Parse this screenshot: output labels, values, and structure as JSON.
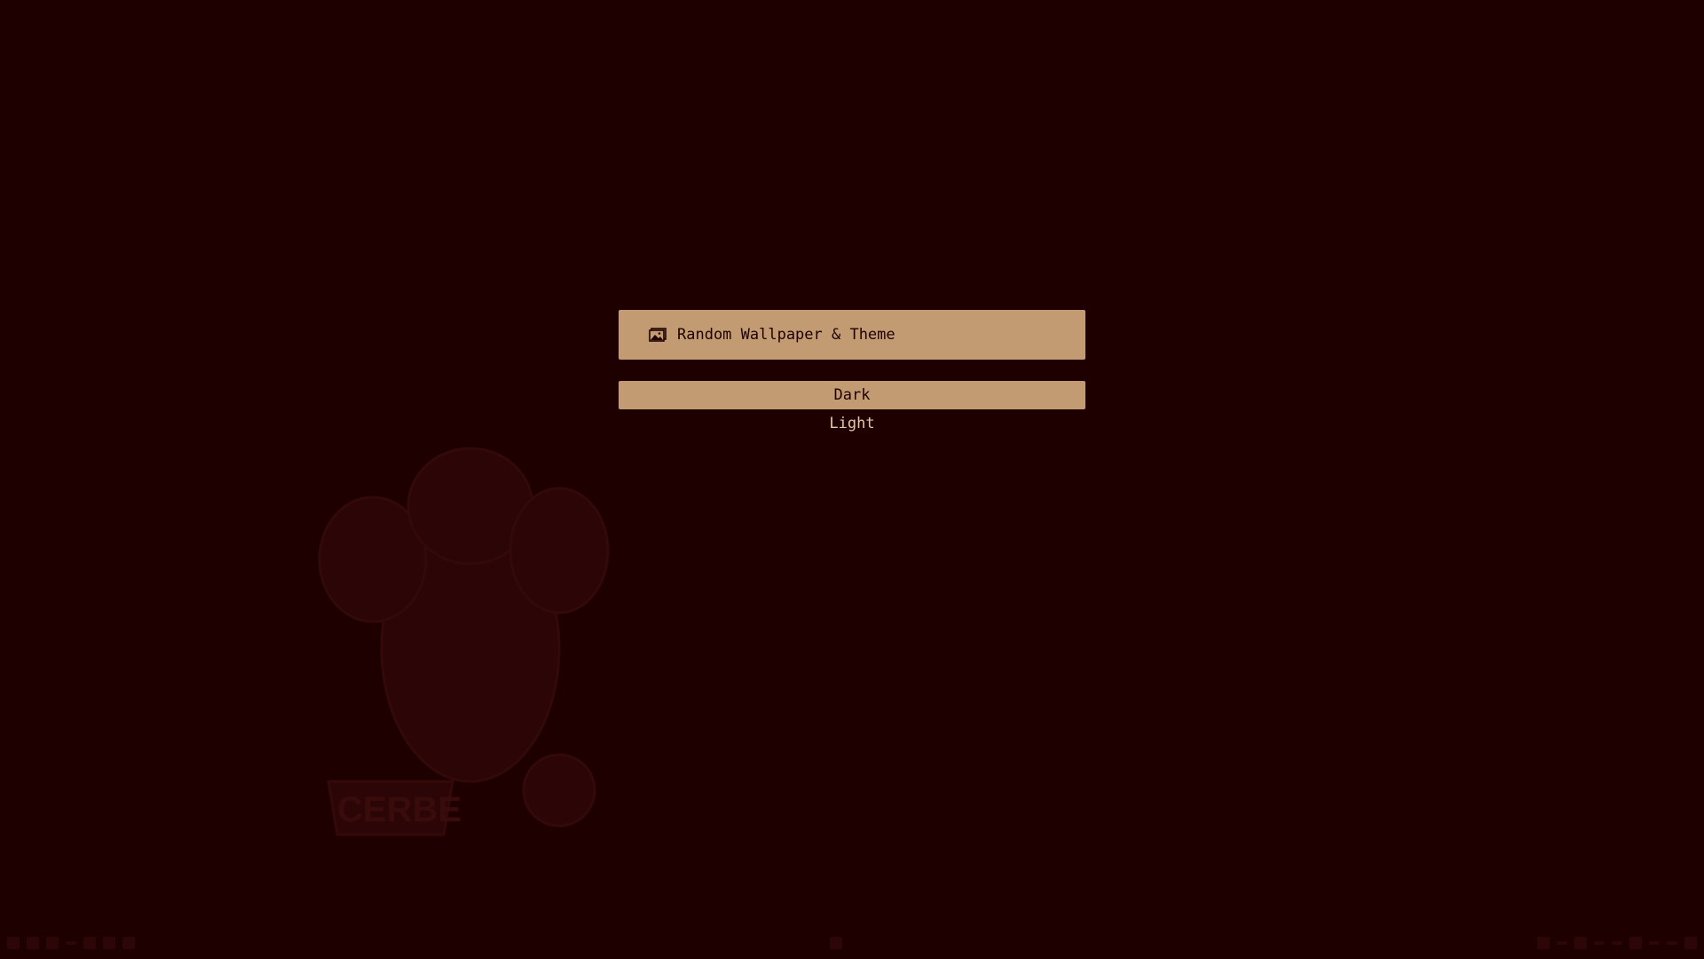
{
  "menu": {
    "title": "Random Wallpaper & Theme",
    "title_icon": "image-icon",
    "options": [
      {
        "label": "Dark",
        "selected": true
      },
      {
        "label": "Light",
        "selected": false
      }
    ]
  },
  "wallpaper": {
    "text": "CERBE"
  },
  "colors": {
    "background": "#1f0000",
    "accent": "#c39b73",
    "text_light": "#e6c7a8",
    "wallpaper_art": "#330808"
  }
}
